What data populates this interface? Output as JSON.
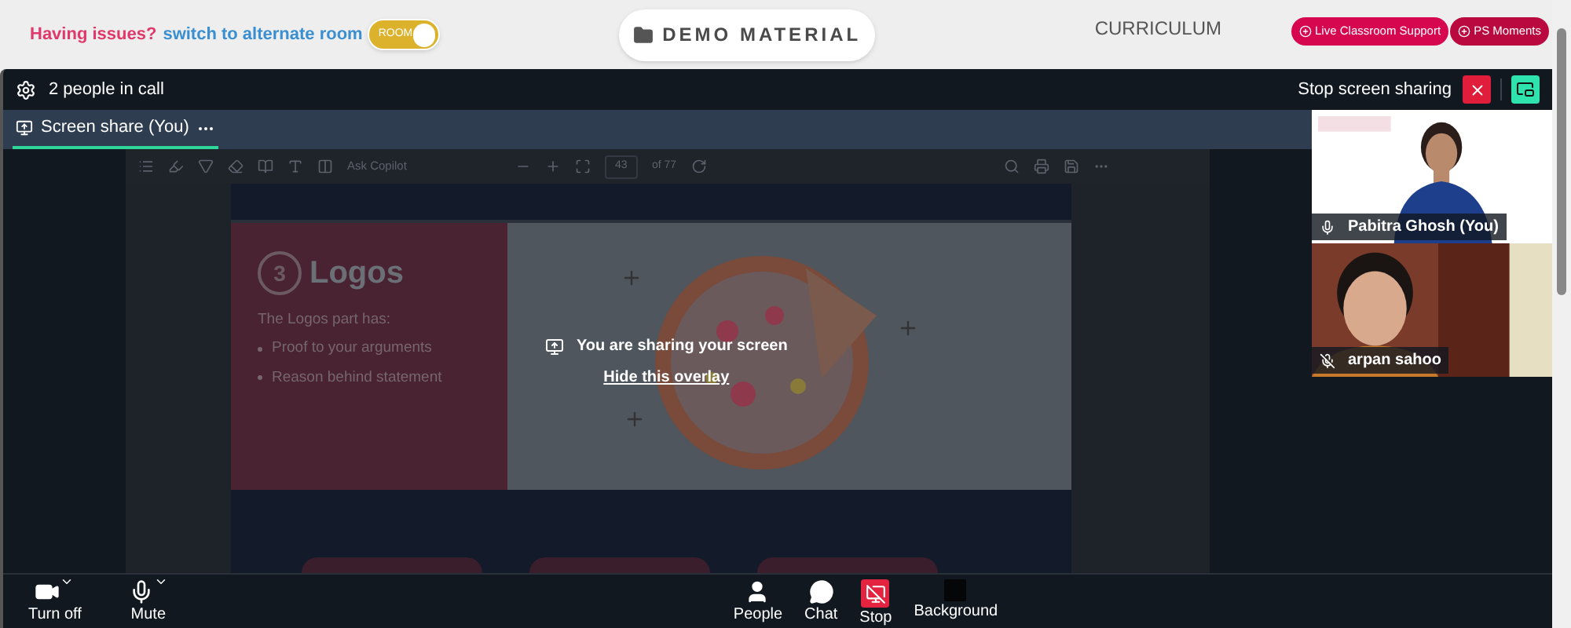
{
  "top_bar": {
    "issue_prompt": "Having issues?",
    "switch_link": "switch to alternate room",
    "room_toggle": {
      "label": "ROOM",
      "on": true
    },
    "demo_button": "DEMO MATERIAL",
    "curriculum": "CURRICULUM",
    "pills": [
      "Live Classroom Support",
      "PS Moments"
    ]
  },
  "call": {
    "people_count": "2 people in call",
    "stop_sharing": "Stop screen sharing",
    "tabs": [
      {
        "label": "Screen share (You)",
        "selected": true
      }
    ],
    "shared_screen": {
      "toolbar": {
        "search": "Ask Copilot",
        "page": "43",
        "page_total": "of 77"
      },
      "slide": {
        "number": "3",
        "title": "Logos",
        "intro": "The Logos part has:",
        "bullets": [
          "Proof to your arguments",
          "Reason behind statement"
        ]
      }
    },
    "overlay": {
      "message": "You are sharing your screen",
      "link": "Hide this overlay"
    },
    "participants": [
      {
        "name": "Pabitra Ghosh (You)",
        "muted": false,
        "kind": "light"
      },
      {
        "name": "arpan sahoo",
        "muted": true,
        "kind": "room"
      }
    ],
    "controls": [
      {
        "label": "Turn off",
        "kind": "camera",
        "has_menu": true
      },
      {
        "label": "Mute",
        "kind": "mic",
        "has_menu": true
      },
      {
        "label": "People",
        "kind": "people",
        "has_menu": false
      },
      {
        "label": "Chat",
        "kind": "chat",
        "has_menu": false
      },
      {
        "label": "Stop",
        "kind": "stop",
        "has_menu": false
      },
      {
        "label": "Background",
        "kind": "background",
        "has_menu": false
      }
    ]
  }
}
